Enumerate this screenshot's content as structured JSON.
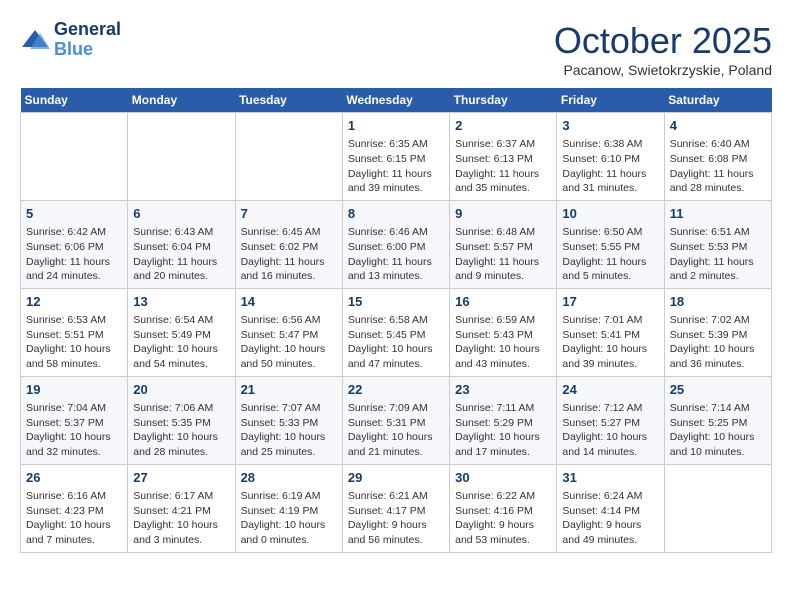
{
  "header": {
    "logo_line1": "General",
    "logo_line2": "Blue",
    "month": "October 2025",
    "location": "Pacanow, Swietokrzyskie, Poland"
  },
  "days_of_week": [
    "Sunday",
    "Monday",
    "Tuesday",
    "Wednesday",
    "Thursday",
    "Friday",
    "Saturday"
  ],
  "weeks": [
    [
      {
        "day": "",
        "info": ""
      },
      {
        "day": "",
        "info": ""
      },
      {
        "day": "",
        "info": ""
      },
      {
        "day": "1",
        "info": "Sunrise: 6:35 AM\nSunset: 6:15 PM\nDaylight: 11 hours\nand 39 minutes."
      },
      {
        "day": "2",
        "info": "Sunrise: 6:37 AM\nSunset: 6:13 PM\nDaylight: 11 hours\nand 35 minutes."
      },
      {
        "day": "3",
        "info": "Sunrise: 6:38 AM\nSunset: 6:10 PM\nDaylight: 11 hours\nand 31 minutes."
      },
      {
        "day": "4",
        "info": "Sunrise: 6:40 AM\nSunset: 6:08 PM\nDaylight: 11 hours\nand 28 minutes."
      }
    ],
    [
      {
        "day": "5",
        "info": "Sunrise: 6:42 AM\nSunset: 6:06 PM\nDaylight: 11 hours\nand 24 minutes."
      },
      {
        "day": "6",
        "info": "Sunrise: 6:43 AM\nSunset: 6:04 PM\nDaylight: 11 hours\nand 20 minutes."
      },
      {
        "day": "7",
        "info": "Sunrise: 6:45 AM\nSunset: 6:02 PM\nDaylight: 11 hours\nand 16 minutes."
      },
      {
        "day": "8",
        "info": "Sunrise: 6:46 AM\nSunset: 6:00 PM\nDaylight: 11 hours\nand 13 minutes."
      },
      {
        "day": "9",
        "info": "Sunrise: 6:48 AM\nSunset: 5:57 PM\nDaylight: 11 hours\nand 9 minutes."
      },
      {
        "day": "10",
        "info": "Sunrise: 6:50 AM\nSunset: 5:55 PM\nDaylight: 11 hours\nand 5 minutes."
      },
      {
        "day": "11",
        "info": "Sunrise: 6:51 AM\nSunset: 5:53 PM\nDaylight: 11 hours\nand 2 minutes."
      }
    ],
    [
      {
        "day": "12",
        "info": "Sunrise: 6:53 AM\nSunset: 5:51 PM\nDaylight: 10 hours\nand 58 minutes."
      },
      {
        "day": "13",
        "info": "Sunrise: 6:54 AM\nSunset: 5:49 PM\nDaylight: 10 hours\nand 54 minutes."
      },
      {
        "day": "14",
        "info": "Sunrise: 6:56 AM\nSunset: 5:47 PM\nDaylight: 10 hours\nand 50 minutes."
      },
      {
        "day": "15",
        "info": "Sunrise: 6:58 AM\nSunset: 5:45 PM\nDaylight: 10 hours\nand 47 minutes."
      },
      {
        "day": "16",
        "info": "Sunrise: 6:59 AM\nSunset: 5:43 PM\nDaylight: 10 hours\nand 43 minutes."
      },
      {
        "day": "17",
        "info": "Sunrise: 7:01 AM\nSunset: 5:41 PM\nDaylight: 10 hours\nand 39 minutes."
      },
      {
        "day": "18",
        "info": "Sunrise: 7:02 AM\nSunset: 5:39 PM\nDaylight: 10 hours\nand 36 minutes."
      }
    ],
    [
      {
        "day": "19",
        "info": "Sunrise: 7:04 AM\nSunset: 5:37 PM\nDaylight: 10 hours\nand 32 minutes."
      },
      {
        "day": "20",
        "info": "Sunrise: 7:06 AM\nSunset: 5:35 PM\nDaylight: 10 hours\nand 28 minutes."
      },
      {
        "day": "21",
        "info": "Sunrise: 7:07 AM\nSunset: 5:33 PM\nDaylight: 10 hours\nand 25 minutes."
      },
      {
        "day": "22",
        "info": "Sunrise: 7:09 AM\nSunset: 5:31 PM\nDaylight: 10 hours\nand 21 minutes."
      },
      {
        "day": "23",
        "info": "Sunrise: 7:11 AM\nSunset: 5:29 PM\nDaylight: 10 hours\nand 17 minutes."
      },
      {
        "day": "24",
        "info": "Sunrise: 7:12 AM\nSunset: 5:27 PM\nDaylight: 10 hours\nand 14 minutes."
      },
      {
        "day": "25",
        "info": "Sunrise: 7:14 AM\nSunset: 5:25 PM\nDaylight: 10 hours\nand 10 minutes."
      }
    ],
    [
      {
        "day": "26",
        "info": "Sunrise: 6:16 AM\nSunset: 4:23 PM\nDaylight: 10 hours\nand 7 minutes."
      },
      {
        "day": "27",
        "info": "Sunrise: 6:17 AM\nSunset: 4:21 PM\nDaylight: 10 hours\nand 3 minutes."
      },
      {
        "day": "28",
        "info": "Sunrise: 6:19 AM\nSunset: 4:19 PM\nDaylight: 10 hours\nand 0 minutes."
      },
      {
        "day": "29",
        "info": "Sunrise: 6:21 AM\nSunset: 4:17 PM\nDaylight: 9 hours\nand 56 minutes."
      },
      {
        "day": "30",
        "info": "Sunrise: 6:22 AM\nSunset: 4:16 PM\nDaylight: 9 hours\nand 53 minutes."
      },
      {
        "day": "31",
        "info": "Sunrise: 6:24 AM\nSunset: 4:14 PM\nDaylight: 9 hours\nand 49 minutes."
      },
      {
        "day": "",
        "info": ""
      }
    ]
  ]
}
